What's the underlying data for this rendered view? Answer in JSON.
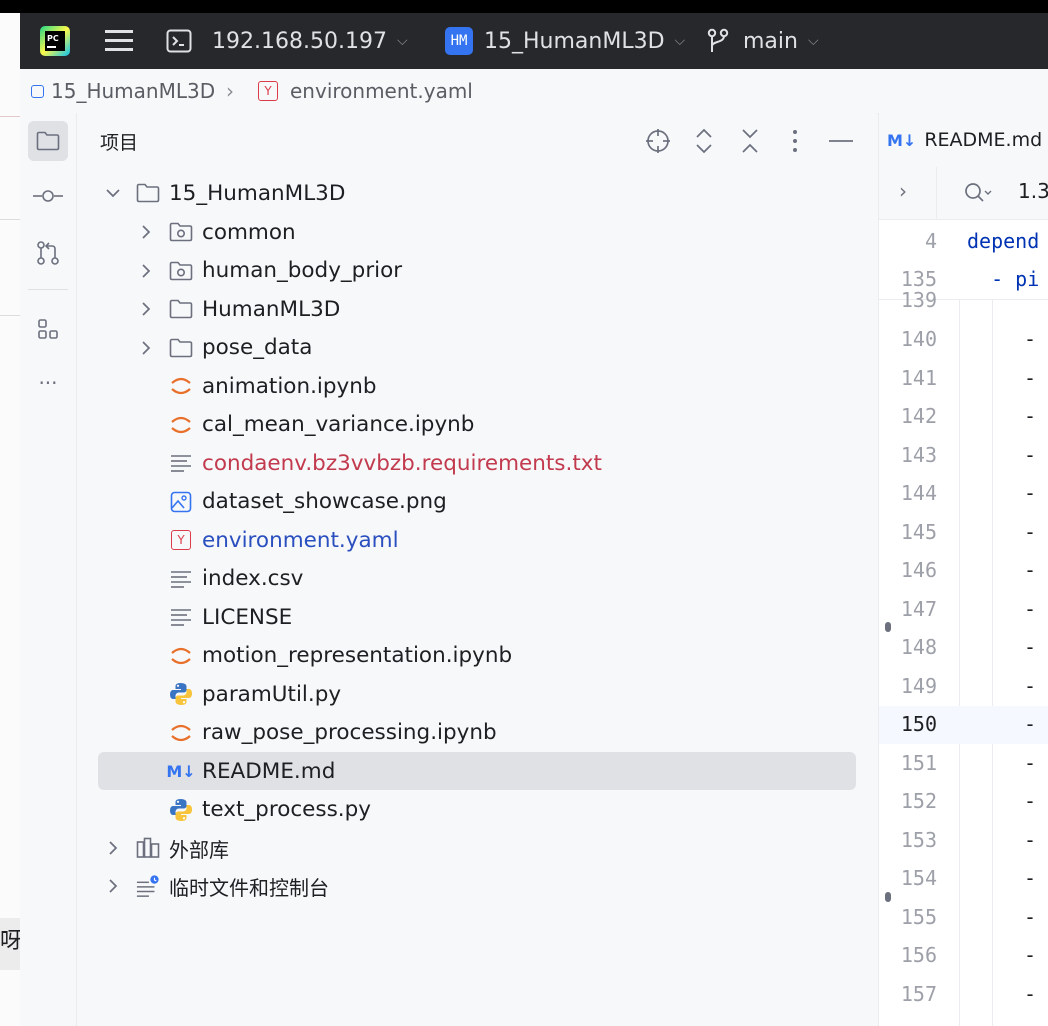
{
  "titlebar": {
    "host": "192.168.50.197",
    "project_badge": "HM",
    "project": "15_HumanML3D",
    "branch": "main",
    "colors": {
      "bg": "#27282c",
      "badge": "#3574f0"
    }
  },
  "breadcrumb": {
    "project": "15_HumanML3D",
    "yaml_badge": "Y",
    "file": "environment.yaml"
  },
  "panel": {
    "title": "项目"
  },
  "tree": {
    "root": "15_HumanML3D",
    "items": [
      {
        "label": "common",
        "type": "module-folder"
      },
      {
        "label": "human_body_prior",
        "type": "module-folder"
      },
      {
        "label": "HumanML3D",
        "type": "folder"
      },
      {
        "label": "pose_data",
        "type": "folder"
      },
      {
        "label": "animation.ipynb",
        "type": "notebook"
      },
      {
        "label": "cal_mean_variance.ipynb",
        "type": "notebook"
      },
      {
        "label": "condaenv.bz3vvbzb.requirements.txt",
        "type": "text",
        "color": "#c23a4d"
      },
      {
        "label": "dataset_showcase.png",
        "type": "image"
      },
      {
        "label": "environment.yaml",
        "type": "yaml",
        "color": "#2a4fbf"
      },
      {
        "label": "index.csv",
        "type": "text"
      },
      {
        "label": "LICENSE",
        "type": "text"
      },
      {
        "label": "motion_representation.ipynb",
        "type": "notebook"
      },
      {
        "label": "paramUtil.py",
        "type": "python"
      },
      {
        "label": "raw_pose_processing.ipynb",
        "type": "notebook"
      },
      {
        "label": "README.md",
        "type": "markdown",
        "selected": true
      },
      {
        "label": "text_process.py",
        "type": "python"
      }
    ],
    "external_libs": "外部库",
    "scratches": "临时文件和控制台"
  },
  "editor": {
    "tab_icon": "M↓",
    "tab_label": "README.md",
    "search_value": "1.3",
    "sticky": [
      {
        "num": "4",
        "code": "depend"
      },
      {
        "num": "135",
        "code": "  - pi"
      }
    ],
    "partial_num": "139",
    "lines": [
      "140",
      "141",
      "142",
      "143",
      "144",
      "145",
      "146",
      "147",
      "148",
      "149",
      "150",
      "151",
      "152",
      "153",
      "154",
      "155",
      "156",
      "157"
    ],
    "dash": "-",
    "current_line": "150"
  },
  "left_strip_text": "呀"
}
